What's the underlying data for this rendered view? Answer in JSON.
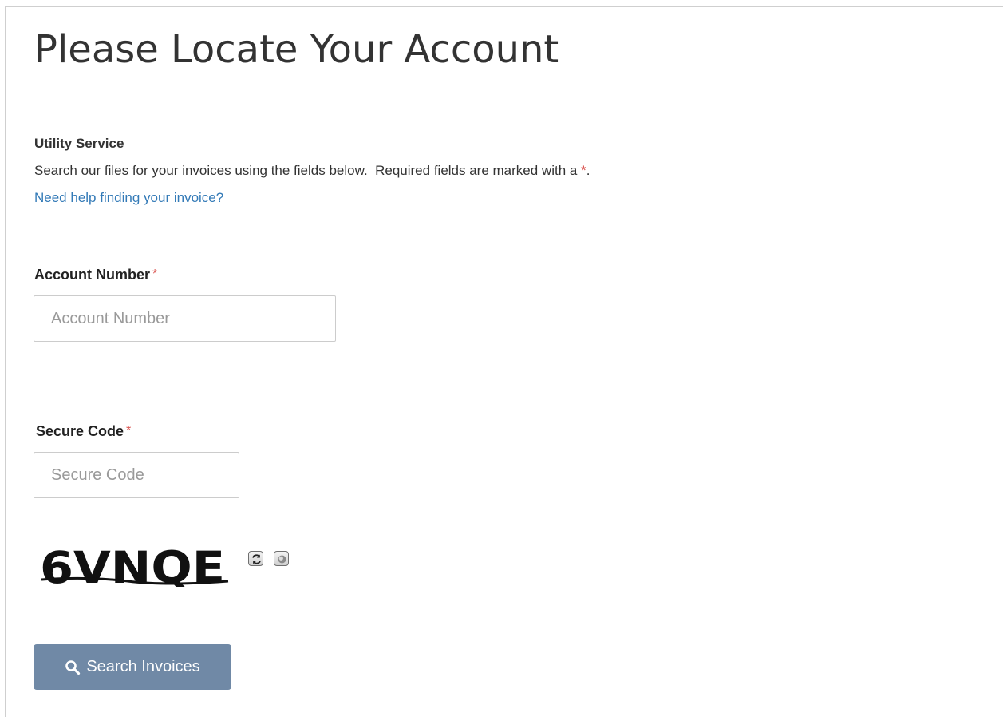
{
  "page": {
    "title": "Please Locate Your Account"
  },
  "section": {
    "heading": "Utility Service",
    "intro_text": "Search our files for your invoices using the fields below.  Required fields are marked with a ",
    "required_marker": "*",
    "intro_end": ".",
    "help_link": "Need help finding your invoice?"
  },
  "account_field": {
    "label": "Account Number",
    "required_marker": "*",
    "placeholder": "Account Number",
    "value": ""
  },
  "secure_code_field": {
    "label": "Secure Code",
    "required_marker": "*",
    "placeholder": "Secure Code",
    "value": ""
  },
  "captcha": {
    "text": "6VNQE",
    "refresh_icon": "refresh-icon",
    "audio_icon": "audio-icon"
  },
  "actions": {
    "search_label": "Search Invoices",
    "search_icon": "search-icon"
  },
  "colors": {
    "link": "#337ab7",
    "required": "#d9534f",
    "button": "#7089a6"
  }
}
